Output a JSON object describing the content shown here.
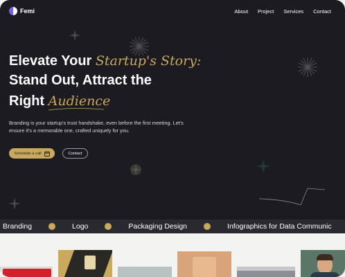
{
  "brand": {
    "name": "Femi",
    "accent": "#c9a95c",
    "background": "#1c1b22"
  },
  "nav": {
    "links": [
      "About",
      "Project",
      "Services",
      "Contact"
    ]
  },
  "hero": {
    "line1_plain": "Elevate Your ",
    "line1_script": "Startup's Story:",
    "line2": "Stand Out, Attract the",
    "line3_plain": "Right ",
    "line3_script": "Audience",
    "description": "Branding is your startup's trust handshake, even before the first meeting. Let's ensure it's a memorable one, crafted uniquely for you.",
    "cta_primary": "Schedule a call",
    "cta_primary_icon": "calendar-icon",
    "cta_secondary": "Contact"
  },
  "marquee": {
    "items": [
      "Branding",
      "Logo",
      "Packaging Design",
      "Infographics for Data Communic"
    ]
  }
}
